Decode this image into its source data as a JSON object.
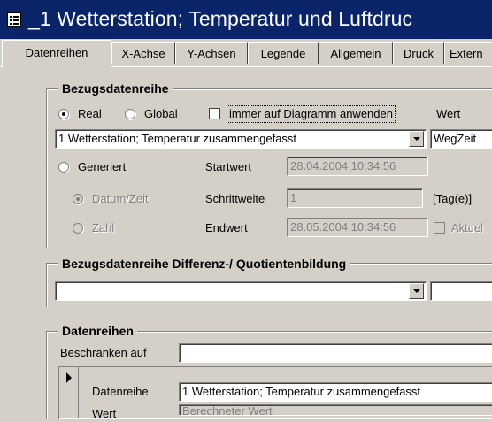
{
  "window": {
    "title": "_1 Wetterstation; Temperatur und Luftdruc",
    "icon": "form-icon"
  },
  "tabs": [
    {
      "label": "Datenreihen",
      "active": true
    },
    {
      "label": "X-Achse",
      "active": false
    },
    {
      "label": "Y-Achsen",
      "active": false
    },
    {
      "label": "Legende",
      "active": false
    },
    {
      "label": "Allgemein",
      "active": false
    },
    {
      "label": "Druck",
      "active": false
    },
    {
      "label": "Extern",
      "active": false
    }
  ],
  "bezug": {
    "title": "Bezugsdatenreihe",
    "real_label": "Real",
    "global_label": "Global",
    "always_apply_label": "immer auf Diagramm anwenden",
    "wert_label": "Wert",
    "series_value": "1 Wetterstation; Temperatur zusammengefasst",
    "wert_value": "WegZeit",
    "generiert_label": "Generiert",
    "datum_zeit_label": "Datum/Zeit",
    "zahl_label": "Zahl",
    "startwert_label": "Startwert",
    "startwert_value": "28.04.2004 10:34:56",
    "schrittweite_label": "Schrittweite",
    "schrittweite_value": "1",
    "unit_label": "[Tag(e)]",
    "endwert_label": "Endwert",
    "endwert_value": "28.05.2004 10:34:56",
    "aktuell_label": "Aktuel"
  },
  "differenz": {
    "title": "Bezugsdatenreihe Differenz-/ Quotientenbildung",
    "value": "",
    "second_value": ""
  },
  "datenreihen": {
    "title": "Datenreihen",
    "beschraenken_label": "Beschränken auf",
    "beschraenken_value": "",
    "datenreihe_label": "Datenreihe",
    "datenreihe_value": "1 Wetterstation; Temperatur zusammengefasst",
    "wert_label": "Wert",
    "wert_value": "Berechneter Wert"
  }
}
